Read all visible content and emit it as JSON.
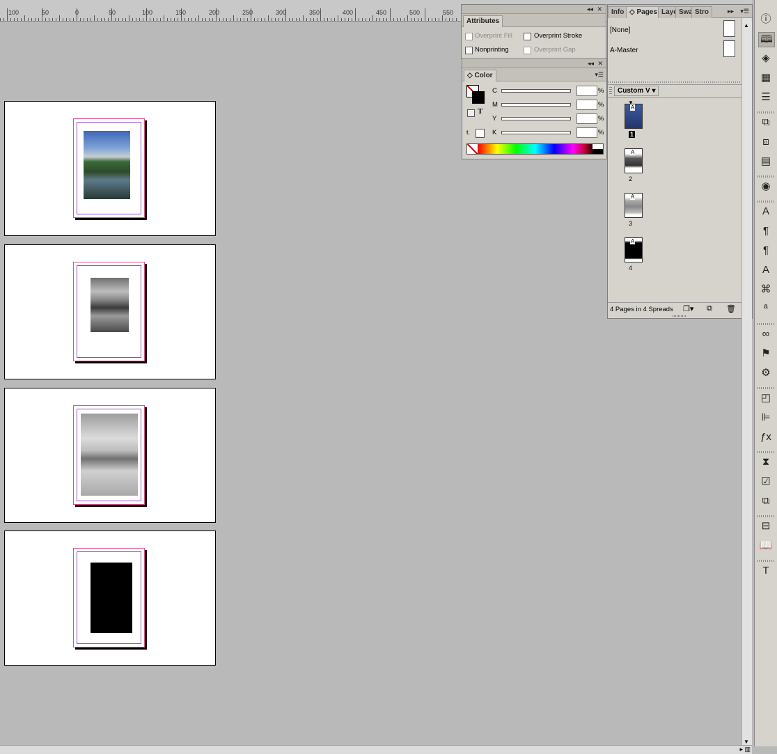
{
  "ruler": {
    "labels": [
      "100",
      "50",
      "0",
      "50",
      "100",
      "150",
      "200",
      "250",
      "300",
      "350",
      "400",
      "450",
      "500",
      "550"
    ]
  },
  "attributes_panel": {
    "tab": "Attributes",
    "overprint_fill": "Overprint Fill",
    "overprint_stroke": "Overprint Stroke",
    "nonprinting": "Nonprinting",
    "overprint_gap": "Overprint Gap"
  },
  "color_panel": {
    "tab": "Color",
    "channels": [
      "C",
      "M",
      "Y",
      "K"
    ],
    "percent": "%"
  },
  "pages_panel": {
    "tabs": [
      "Info",
      "Pages",
      "Laye",
      "Swa",
      "Stro"
    ],
    "masters": [
      "[None]",
      "A-Master"
    ],
    "view_menu": "Custom V",
    "pages": [
      {
        "label": "1",
        "master": "A"
      },
      {
        "label": "2",
        "master": "A"
      },
      {
        "label": "3",
        "master": "A"
      },
      {
        "label": "4",
        "master": "A"
      }
    ],
    "status": "4 Pages in 4 Spreads"
  },
  "toolbar": {
    "icons": [
      "info-icon",
      "pages-icon",
      "layers-icon",
      "swatches-icon",
      "stroke-icon",
      "links-icon",
      "page-object-icon",
      "table-icon",
      "effects-icon",
      "character-icon",
      "paragraph-icon",
      "paragraph-styles-icon",
      "character-styles-icon",
      "glyphs-icon",
      "spellcheck-icon",
      "hyperlinks-icon",
      "bookmarks-icon",
      "cross-reference-icon",
      "pathfinder-icon",
      "align-icon",
      "fx-icon",
      "script-icon",
      "preflight-icon",
      "transform-icon",
      "text-wrap-icon",
      "book-icon",
      "type-icon"
    ]
  },
  "colors": {
    "panel_bg": "#d6d3cc",
    "canvas_bg": "#b9b9b9",
    "margin_guide": "#9a47d6",
    "bleed_guide": "#e0508f"
  }
}
